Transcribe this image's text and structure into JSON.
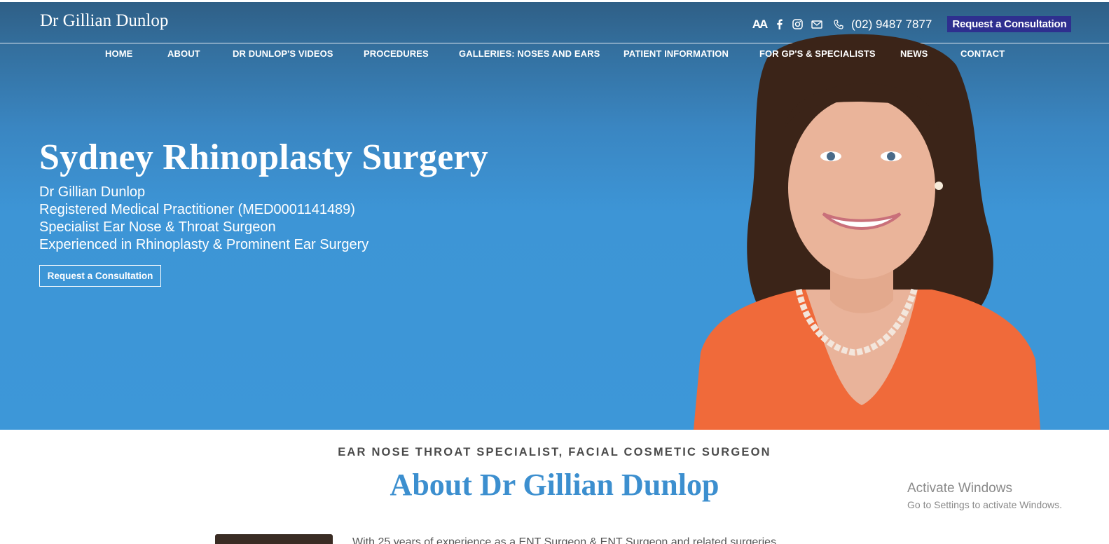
{
  "site": {
    "title": "Dr Gillian Dunlop"
  },
  "topbar": {
    "icons": [
      "font-size-icon",
      "facebook-icon",
      "instagram-icon",
      "mail-icon",
      "phone-icon"
    ],
    "font_size_glyph": "AA",
    "phone": "(02) 9487 7877",
    "cta_label": "Request a Consultation"
  },
  "nav": {
    "items": [
      {
        "label": "HOME"
      },
      {
        "label": "ABOUT"
      },
      {
        "label": "DR DUNLOP'S VIDEOS"
      },
      {
        "label": "PROCEDURES"
      },
      {
        "label": "GALLERIES: NOSES AND EARS"
      },
      {
        "label": "PATIENT INFORMATION"
      },
      {
        "label": "FOR GP'S & SPECIALISTS"
      },
      {
        "label": "NEWS"
      },
      {
        "label": "CONTACT"
      }
    ]
  },
  "hero": {
    "title": "Sydney Rhinoplasty Surgery",
    "lines": [
      "Dr Gillian Dunlop",
      "Registered Medical Practitioner (MED0001141489)",
      "Specialist Ear Nose & Throat Surgeon",
      "Experienced in Rhinoplasty & Prominent Ear Surgery"
    ],
    "cta_label": "Request a Consultation"
  },
  "about": {
    "kicker": "EAR NOSE THROAT SPECIALIST, FACIAL COSMETIC SURGEON",
    "title": "About Dr Gillian Dunlop",
    "text_fragment": "With 25 years of experience as a ENT Surgeon & ENT Surgeon and related surgeries..."
  },
  "watermark": {
    "line1": "Activate Windows",
    "line2": "Go to Settings to activate Windows."
  },
  "colors": {
    "hero_top": "#2f5f86",
    "hero_bottom": "#3d97d8",
    "cta_top_bg": "#2e2f8f",
    "about_title": "#3c8fcf"
  }
}
